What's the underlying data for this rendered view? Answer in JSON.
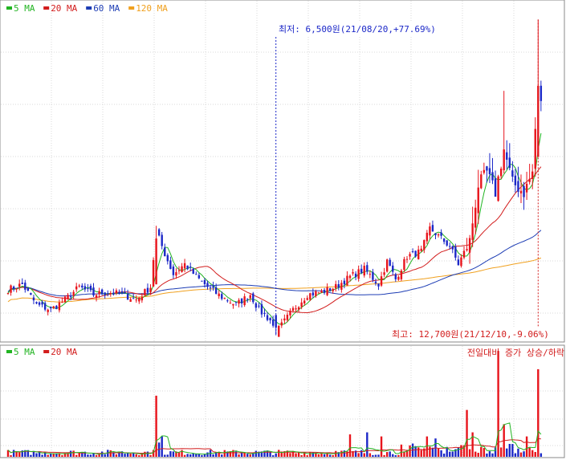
{
  "colors": {
    "up": "#e8141c",
    "down": "#1c28c8",
    "ma5": "#22b422",
    "ma20": "#d21c1c",
    "ma60": "#1c3cb4",
    "ma120": "#f0a01e",
    "grid": "#d9d9d9",
    "border": "#888888",
    "annotation_low": "#1c28c8",
    "annotation_high": "#d21c1c"
  },
  "price_legend": [
    {
      "label": "5 MA",
      "color_key": "ma5"
    },
    {
      "label": "20 MA",
      "color_key": "ma20"
    },
    {
      "label": "60 MA",
      "color_key": "ma60"
    },
    {
      "label": "120 MA",
      "color_key": "ma120"
    }
  ],
  "volume_legend": [
    {
      "label": "5 MA",
      "color_key": "ma5"
    },
    {
      "label": "20 MA",
      "color_key": "ma20"
    }
  ],
  "annotations": {
    "low_text": "최저: 6,500원(21/08/20,+77.69%)",
    "high_text": "최고: 12,700원(21/12/10,-9.06%)",
    "volume_caption": "전일대비 증가 상승/하락"
  },
  "chart_data": [
    {
      "type": "candlestick",
      "title": "",
      "ylim": [
        6400,
        12800
      ],
      "low_marker": {
        "value": 6500,
        "date": "21/08/20",
        "index": 94
      },
      "high_marker": {
        "value": 12700,
        "date": "21/12/10",
        "index": 186
      },
      "anchors": [
        [
          0,
          7400
        ],
        [
          5,
          7500
        ],
        [
          10,
          7100
        ],
        [
          15,
          7000
        ],
        [
          20,
          7200
        ],
        [
          25,
          7450
        ],
        [
          30,
          7300
        ],
        [
          35,
          7350
        ],
        [
          40,
          7300
        ],
        [
          45,
          7200
        ],
        [
          50,
          7450
        ],
        [
          52,
          8550
        ],
        [
          55,
          8100
        ],
        [
          58,
          7700
        ],
        [
          62,
          7900
        ],
        [
          66,
          7650
        ],
        [
          70,
          7450
        ],
        [
          75,
          7250
        ],
        [
          80,
          7100
        ],
        [
          85,
          7300
        ],
        [
          88,
          7000
        ],
        [
          92,
          6800
        ],
        [
          94,
          6550
        ],
        [
          96,
          6700
        ],
        [
          100,
          7000
        ],
        [
          105,
          7300
        ],
        [
          110,
          7350
        ],
        [
          115,
          7450
        ],
        [
          120,
          7650
        ],
        [
          125,
          7800
        ],
        [
          130,
          7500
        ],
        [
          133,
          7950
        ],
        [
          136,
          7600
        ],
        [
          140,
          8050
        ],
        [
          145,
          8150
        ],
        [
          148,
          8600
        ],
        [
          152,
          8400
        ],
        [
          155,
          8250
        ],
        [
          158,
          7900
        ],
        [
          162,
          8350
        ],
        [
          165,
          9450
        ],
        [
          168,
          9700
        ],
        [
          171,
          9300
        ],
        [
          174,
          10150
        ],
        [
          177,
          9500
        ],
        [
          181,
          9300
        ],
        [
          184,
          9700
        ],
        [
          186,
          11400
        ]
      ],
      "series": [
        {
          "name": "5 MA",
          "period": 5
        },
        {
          "name": "20 MA",
          "period": 20
        },
        {
          "name": "60 MA",
          "period": 60
        },
        {
          "name": "120 MA",
          "period": 120
        }
      ]
    },
    {
      "type": "bar",
      "title": "",
      "spike_bars": [
        [
          52,
          6.0
        ],
        [
          53,
          1.4
        ],
        [
          54,
          2.0
        ],
        [
          120,
          2.2
        ],
        [
          126,
          2.4
        ],
        [
          131,
          2.0
        ],
        [
          138,
          1.2
        ],
        [
          142,
          1.3
        ],
        [
          147,
          2.0
        ],
        [
          148,
          1.0
        ],
        [
          150,
          1.8
        ],
        [
          161,
          4.6
        ],
        [
          163,
          2.4
        ],
        [
          172,
          10.4
        ],
        [
          174,
          3.2
        ],
        [
          182,
          2.0
        ],
        [
          186,
          8.6
        ]
      ],
      "series": [
        {
          "name": "5 MA",
          "period": 5
        },
        {
          "name": "20 MA",
          "period": 20
        }
      ]
    }
  ]
}
